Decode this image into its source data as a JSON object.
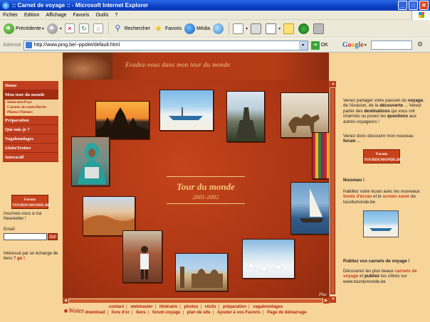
{
  "window": {
    "title": ":: Carnet de voyage :: - Microsoft Internet Explorer",
    "minimize": "_",
    "maximize": "□",
    "close": "✕"
  },
  "menubar": {
    "items": [
      "Fichier",
      "Edition",
      "Affichage",
      "Favoris",
      "Outils",
      "?"
    ]
  },
  "toolbar": {
    "back": "Précédente",
    "search": "Rechercher",
    "favorites": "Favoris",
    "media": "Média",
    "dropdown": "▾"
  },
  "address": {
    "label": "Adresse",
    "url": "http://www.ping.be/~ppolet/default.html",
    "go": "OK",
    "google": [
      "G",
      "o",
      "o",
      "g",
      "l",
      "e"
    ]
  },
  "icons": {
    "back": "back-icon",
    "forward": "forward-icon",
    "stop": "stop-icon",
    "refresh": "refresh-icon",
    "home": "home-icon",
    "search": "search-icon",
    "favorites": "star-icon",
    "media": "media-icon",
    "history": "history-icon",
    "mail": "mail-icon",
    "print": "print-icon",
    "edit": "edit-icon",
    "note": "note-icon",
    "messenger": "messenger-icon",
    "tools": "gear-icon"
  },
  "page": {
    "banner": "Evadez-vous dans mon tour du monde",
    "title": "Tour du monde",
    "years": "2001-2002",
    "next": "Plus",
    "nav": [
      "Home",
      "Mon tour du monde",
      "Préparation",
      "Qui suis-je ?",
      "Vagabondages",
      "GlobeTrotter",
      "Interactif"
    ],
    "subnav": [
      "Itinéraire/Pays",
      "Carnets de route/Récits",
      "Photos/Thèmes"
    ],
    "logo": [
      "Forum",
      "TOURDUMONDE.BE"
    ],
    "newsletter": {
      "intro": "Inscrivez-vous à ma Newsletter !",
      "email_label": "Email:",
      "submit": "Go!"
    },
    "link_exchange": {
      "text": "Intéressé par un échange de liens ?",
      "go": "go !"
    },
    "right": {
      "p1": [
        "Venez partager votre passion du ",
        "voyage",
        ", de l'évasion, de la ",
        "découverte",
        " ... Venez parler des ",
        "destinations",
        " qui vous ont charmés ou posez les ",
        "questions",
        " aux autres voyageurs !"
      ],
      "p2": [
        "Venez donc découvrir mon nouveau ",
        "forum",
        " ..."
      ],
      "nouveau_title": "Nouveau !",
      "p3": [
        "Habillez votre écran avec les nouveaux ",
        "fonds d'écran",
        " et le ",
        "screen saver",
        " de tourdumonde.be"
      ],
      "pub_title": "Publiez vos carnets de voyage !",
      "p4": [
        "Découvrez les plus beaux ",
        "carnets de voyage",
        " et ",
        "publiez",
        " les vôtres sur www.tourdumonde.be"
      ]
    },
    "footer": {
      "row1": [
        "contact",
        "webmaster",
        "itinéraire",
        "photos",
        "récits",
        "préparation",
        "vagabondages"
      ],
      "row2": [
        "download",
        "livre d'or",
        "liens",
        "forum voyage",
        "plan de site",
        "Ajouter à vos Favoris",
        "Page de démarrage"
      ],
      "sep": "|"
    },
    "brand": "Wotez"
  },
  "colors": {
    "nav": "#c03e1e",
    "panel": "#b23a15",
    "page_bg": "#f7d49a",
    "title": "#f7c978"
  }
}
